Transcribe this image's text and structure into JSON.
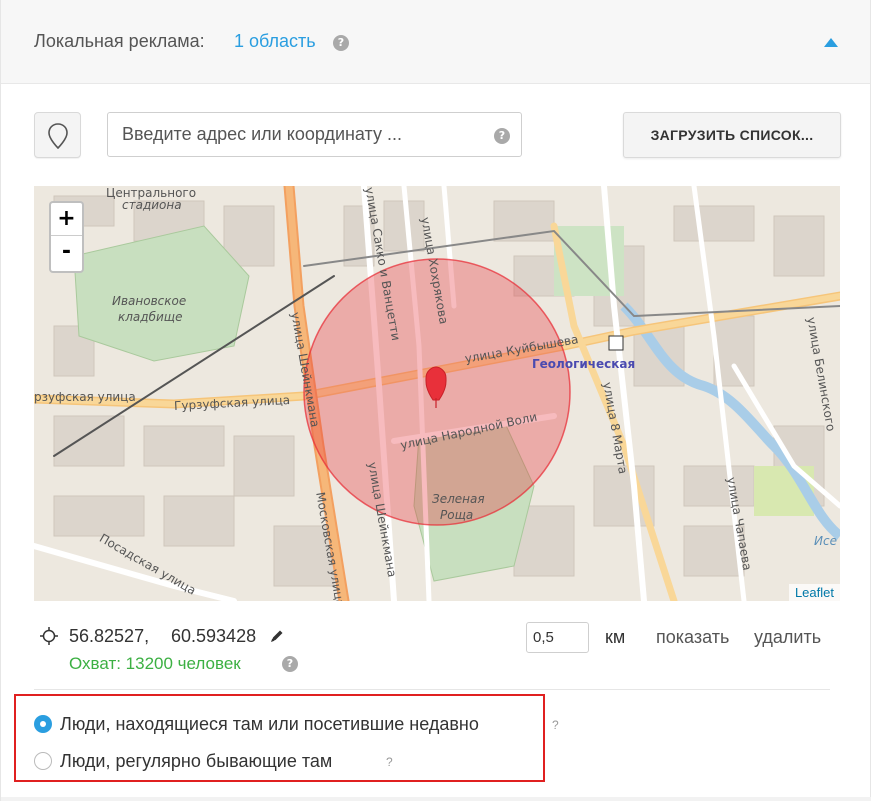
{
  "header": {
    "title": "Локальная реклама:",
    "regions_link": "1 область",
    "help_icon": "question-circle-icon",
    "collapse_icon": "chevron-up-icon",
    "accent_color": "#2a9ee0"
  },
  "search": {
    "pin_icon": "map-pin-outline-icon",
    "placeholder": "Введите адрес или координату ...",
    "value": "",
    "help_icon": "question-circle-icon",
    "load_button": "ЗАГРУЗИТЬ СПИСОК..."
  },
  "map": {
    "zoom_in": "+",
    "zoom_out": "-",
    "attribution": "Leaflet",
    "labels": {
      "stadium": "стадиона",
      "stadium_top": "Центрального",
      "cemetery": "Ивановское кладбище",
      "cemetery_1": "Ивановское",
      "cemetery_2": "кладбище",
      "street_kuibysheva": "улица Куйбышева",
      "street_gurzufskaya": "Гурзуфская улица",
      "street_gurzufskaya_left": "рзуфская улица",
      "street_narodnoy_voli": "улица Народной Воли",
      "street_sheinkmana": "улица Шейнкмана",
      "street_sheinkmana_2": "улица Шейнкмана",
      "street_sacco": "улица Сакко и Ванцетти",
      "street_khokhryakova": "улица Хохрякова",
      "street_moskovskaya": "Московская улица",
      "street_posadskaya": "Посадская улица",
      "street_8_marta": "улица 8 Марта",
      "street_chapaeva": "улица Чапаева",
      "street_belinskogo": "улица Белинского",
      "metro_geologicheskaya": "Геологическая",
      "grove_1": "Зеленая",
      "grove_2": "Роща",
      "river_edge": "Исе"
    },
    "circle_color": "#e8303a",
    "marker_color": "#e8303a"
  },
  "location": {
    "crosshair_icon": "crosshair-icon",
    "lat": "56.82527,",
    "lon": "60.593428",
    "edit_icon": "pencil-icon",
    "reach": "Охват: 13200 человек",
    "reach_color": "#3cb043",
    "radius": "0,5",
    "unit": "км",
    "show": "показать",
    "delete": "удалить"
  },
  "audience": {
    "options": [
      {
        "label": "Люди, находящиеся там или посетившие недавно",
        "selected": true,
        "help": "?"
      },
      {
        "label": "Люди, регулярно бывающие там",
        "selected": false,
        "help": "?"
      }
    ],
    "highlight_color": "#e02020"
  }
}
